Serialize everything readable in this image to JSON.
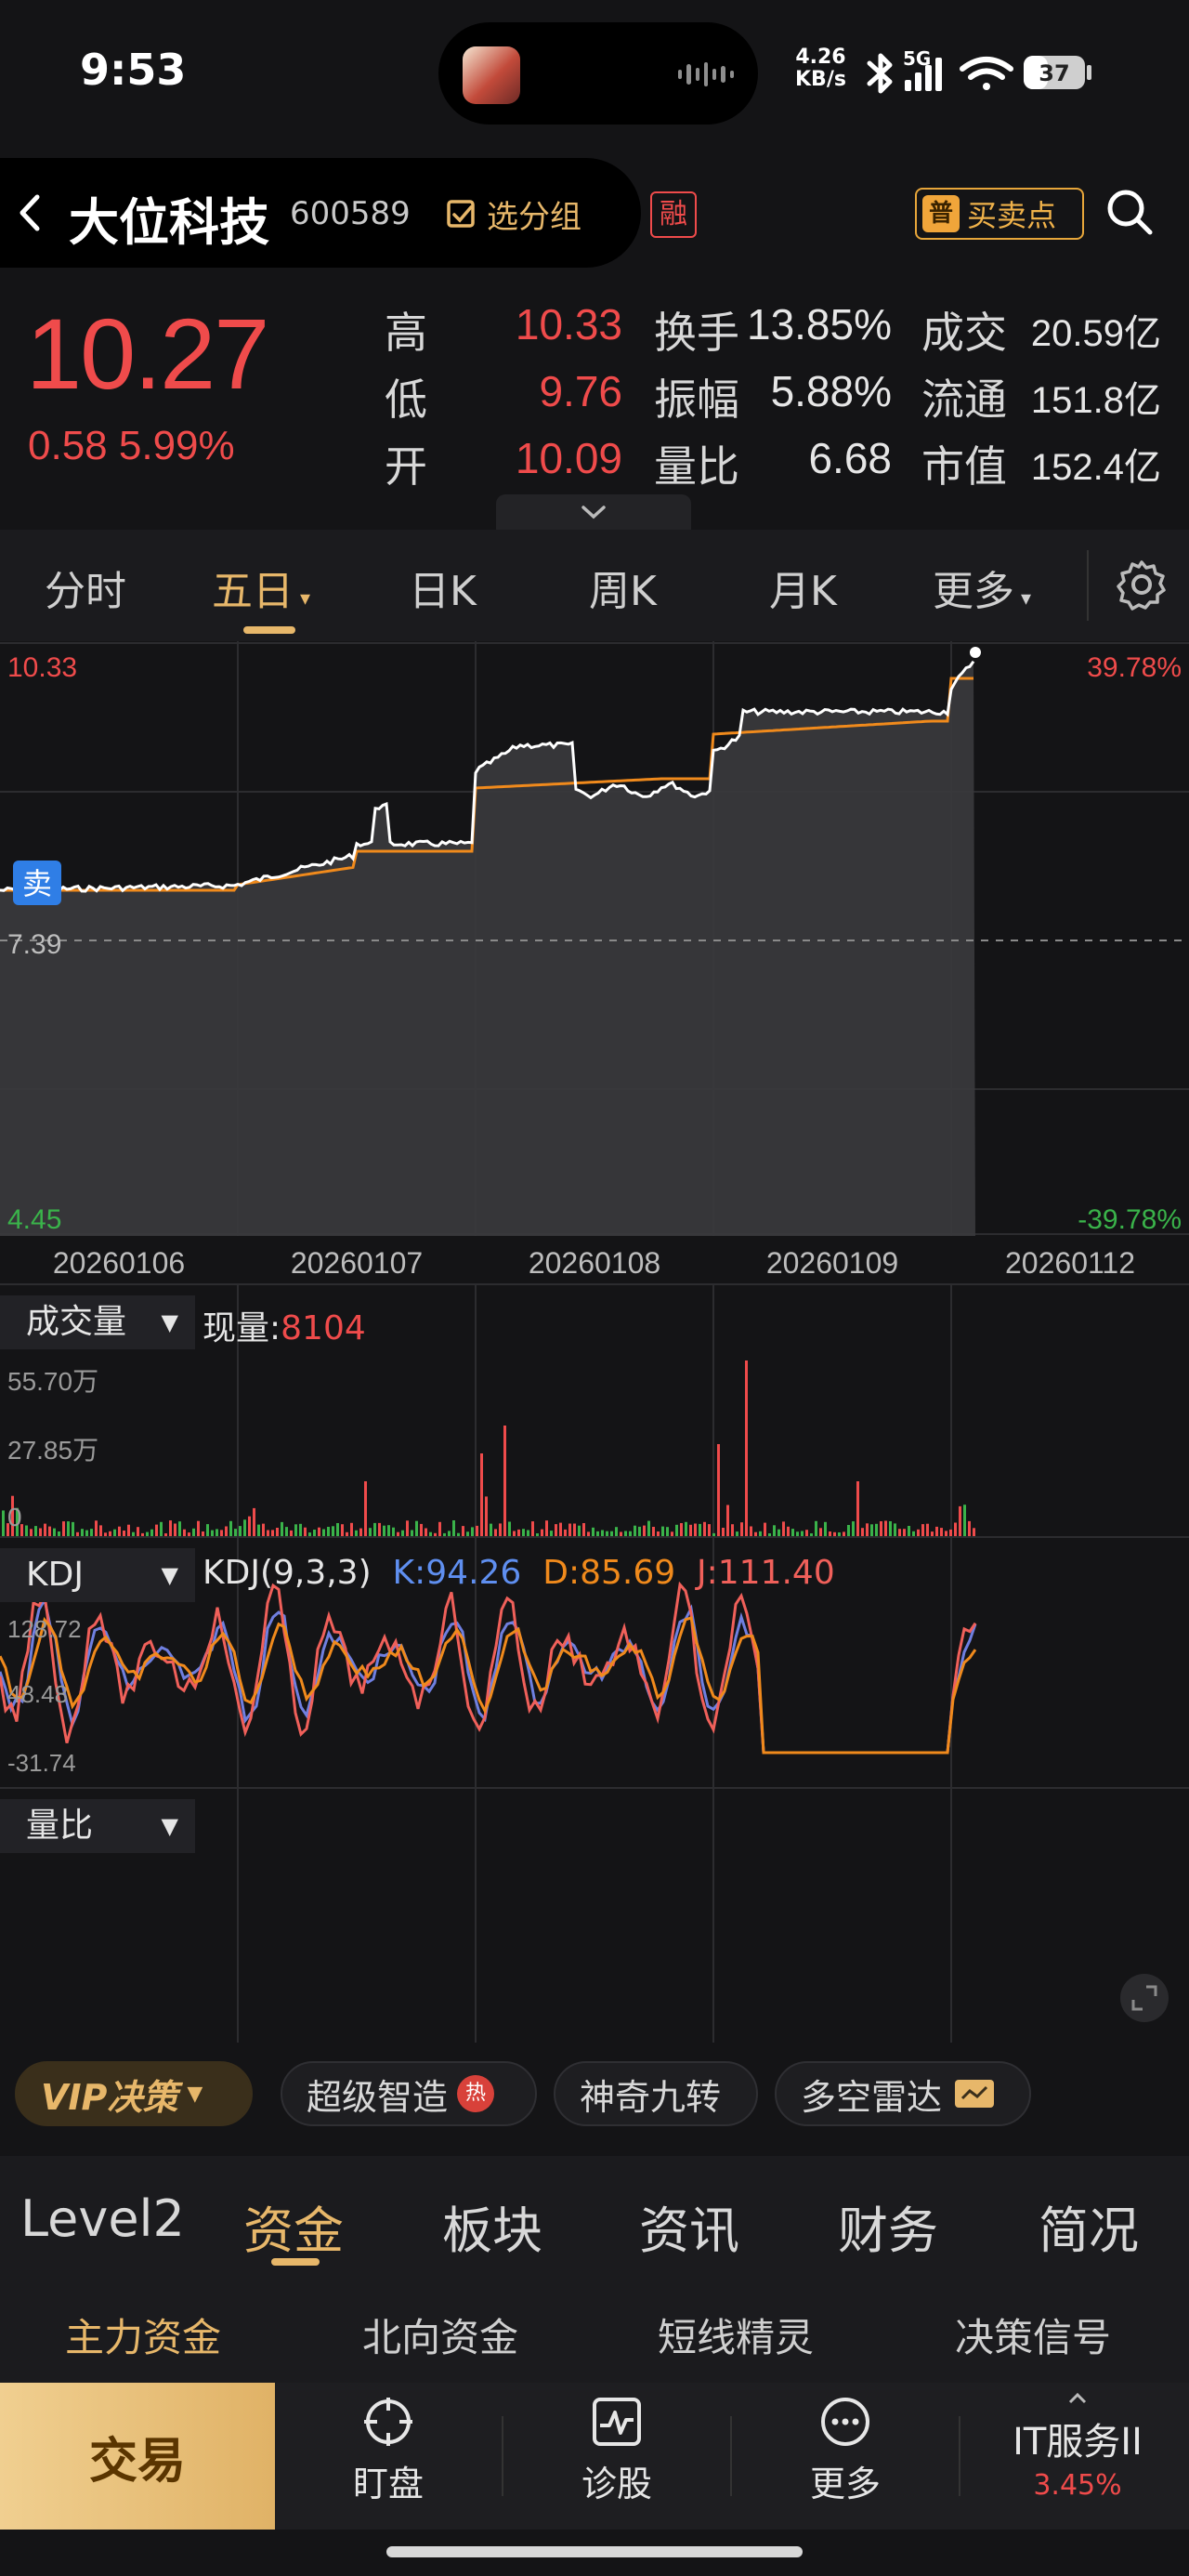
{
  "status_bar": {
    "time": "9:53",
    "net_speed_value": "4.26",
    "net_speed_unit": "KB/s",
    "network": "5G",
    "battery": "37"
  },
  "header": {
    "stock_name": "大位科技",
    "stock_code": "600589",
    "group_button": "选分组",
    "rong_badge": "融",
    "buysell_badge": "普",
    "buysell_label": "买卖点"
  },
  "quote": {
    "price": "10.27",
    "change": "0.58",
    "change_pct": "5.99%",
    "stats": [
      {
        "label": "高",
        "value": "10.33"
      },
      {
        "label": "低",
        "value": "9.76"
      },
      {
        "label": "开",
        "value": "10.09"
      },
      {
        "label": "换手",
        "value": "13.85%"
      },
      {
        "label": "振幅",
        "value": "5.88%"
      },
      {
        "label": "量比",
        "value": "6.68"
      },
      {
        "label": "成交",
        "value": "20.59亿"
      },
      {
        "label": "流通",
        "value": "151.8亿"
      },
      {
        "label": "市值",
        "value": "152.4亿"
      }
    ]
  },
  "period_tabs": [
    "分时",
    "五日",
    "日K",
    "周K",
    "月K",
    "更多"
  ],
  "price_chart": {
    "top_price": "10.33",
    "mid_price": "7.39",
    "bottom_price": "4.45",
    "top_pct": "39.78%",
    "bottom_pct": "-39.78%",
    "sell_marker": "卖",
    "dates": [
      "20260106",
      "20260107",
      "20260108",
      "20260109",
      "20260112"
    ]
  },
  "volume_panel": {
    "selector": "成交量",
    "current_label": "现量:",
    "current_value": "8104",
    "ticks": [
      "55.70万",
      "27.85万",
      "0"
    ]
  },
  "kdj_panel": {
    "selector": "KDJ",
    "params": "KDJ(9,3,3)",
    "k": "K:94.26",
    "d": "D:85.69",
    "j": "J:111.40",
    "ticks": [
      "128.72",
      "48.48",
      "-31.74"
    ]
  },
  "ratio_panel": {
    "selector": "量比"
  },
  "feature_chips": {
    "vip": "VIP决策",
    "items": [
      "超级智造",
      "神奇九转",
      "多空雷达"
    ],
    "hot_badge": "热"
  },
  "main_nav": [
    "Level2",
    "资金",
    "板块",
    "资讯",
    "财务",
    "简况"
  ],
  "sub_nav": [
    "主力资金",
    "北向资金",
    "短线精灵",
    "决策信号"
  ],
  "bottom_bar": {
    "trade": "交易",
    "watch": "盯盘",
    "diagnose": "诊股",
    "more": "更多",
    "sector_name": "IT服务II",
    "sector_pct": "3.45%"
  },
  "colors": {
    "up": "#ef4b4b",
    "down": "#3ab34a",
    "accent": "#e7b76a",
    "avg_line": "#f08a1c",
    "k_line": "#6f7fe0",
    "j_line": "#f0605a",
    "d_line": "#f08a1c"
  }
}
